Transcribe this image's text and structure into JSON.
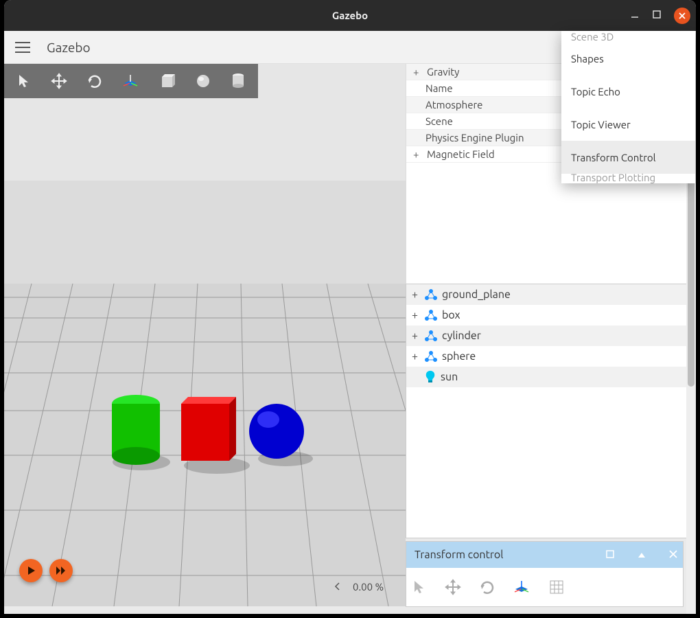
{
  "window": {
    "title": "Gazebo"
  },
  "app": {
    "title": "Gazebo"
  },
  "scene_toolbar": {
    "tools": [
      "select",
      "translate",
      "rotate",
      "transform",
      "box",
      "sphere",
      "cylinder"
    ]
  },
  "properties_tree": {
    "items": [
      {
        "label": "Gravity",
        "expandable": true,
        "indent": 0
      },
      {
        "label": "Name",
        "expandable": false,
        "indent": 1
      },
      {
        "label": "Atmosphere",
        "expandable": false,
        "indent": 1
      },
      {
        "label": "Scene",
        "expandable": false,
        "indent": 1
      },
      {
        "label": "Physics Engine Plugin",
        "expandable": false,
        "indent": 1
      },
      {
        "label": "Magnetic Field",
        "expandable": true,
        "indent": 0
      }
    ]
  },
  "entity_tree": {
    "items": [
      {
        "label": "ground_plane",
        "icon": "model",
        "expandable": true
      },
      {
        "label": "box",
        "icon": "model",
        "expandable": true
      },
      {
        "label": "cylinder",
        "icon": "model",
        "expandable": true
      },
      {
        "label": "sphere",
        "icon": "model",
        "expandable": true
      },
      {
        "label": "sun",
        "icon": "light",
        "expandable": false
      }
    ]
  },
  "transform_panel": {
    "title": "Transform control",
    "tools": [
      "select",
      "translate",
      "rotate",
      "transform",
      "grid"
    ]
  },
  "plugin_menu": {
    "partial_top": "Scene 3D",
    "items": [
      {
        "label": "Shapes",
        "highlight": false
      },
      {
        "label": "Topic Echo",
        "highlight": false
      },
      {
        "label": "Topic Viewer",
        "highlight": false
      },
      {
        "label": "Transform Control",
        "highlight": true
      }
    ],
    "partial_bottom": "Transport Plotting"
  },
  "playback": {
    "progress_text": "0.00 %"
  },
  "scene": {
    "shapes": [
      {
        "type": "cylinder",
        "color": "#11c000"
      },
      {
        "type": "box",
        "color": "#e00000"
      },
      {
        "type": "sphere",
        "color": "#0000d0"
      }
    ]
  }
}
